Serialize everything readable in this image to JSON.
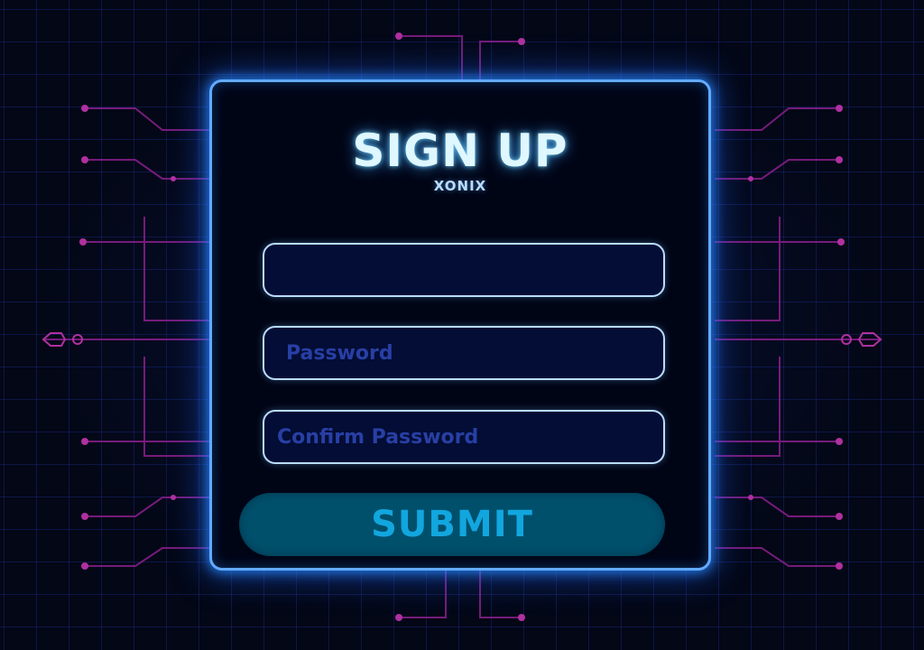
{
  "form": {
    "title": "SIGN UP",
    "brand": "XONIX",
    "fields": [
      {
        "name": "username",
        "value": "",
        "placeholder": ""
      },
      {
        "name": "password",
        "value": "",
        "placeholder": "Password"
      },
      {
        "name": "confirm_password",
        "value": "",
        "placeholder": "Confirm Password"
      }
    ],
    "submit_label": "SUBMIT"
  },
  "colors": {
    "background": "#030716",
    "panel_border": "#63aaff",
    "title_text": "#dff7ff",
    "field_border": "#b8dcff",
    "placeholder_text": "#283fa5",
    "submit_fill": "#00506c",
    "submit_text": "#12a6df",
    "circuit_trace": "#8a1f8c"
  }
}
